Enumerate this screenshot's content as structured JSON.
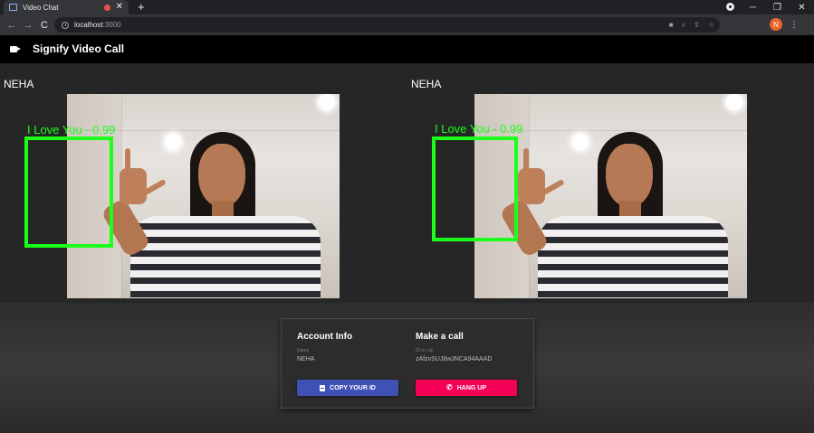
{
  "browser": {
    "tab_title": "Video Chat",
    "tab_close": "✕",
    "new_tab": "+",
    "url_host": "localhost",
    "url_port": ":3000",
    "avatar_letter": "N",
    "window_controls": [
      "─",
      "❐",
      "✕"
    ],
    "nav": [
      "←",
      "→",
      "C"
    ]
  },
  "app": {
    "title": "Signify Video Call",
    "icon": "videocam-icon"
  },
  "videos": [
    {
      "name": "NEHA",
      "detection_label": "I Love You - 0.99"
    },
    {
      "name": "NEHA",
      "detection_label": "I Love You - 0.99"
    }
  ],
  "account_info": {
    "title": "Account Info",
    "name_label": "Name",
    "name_value": "NEHA",
    "copy_button": "COPY YOUR ID"
  },
  "make_call": {
    "title": "Make a call",
    "id_label": "ID to call",
    "id_value": "zAfzvSUJ8wJNCA94AAAD",
    "hangup_button": "HANG UP"
  },
  "colors": {
    "detection": "#1bff1b",
    "copy_button": "#3f51b5",
    "hangup_button": "#f50057",
    "appbar": "#000000"
  }
}
